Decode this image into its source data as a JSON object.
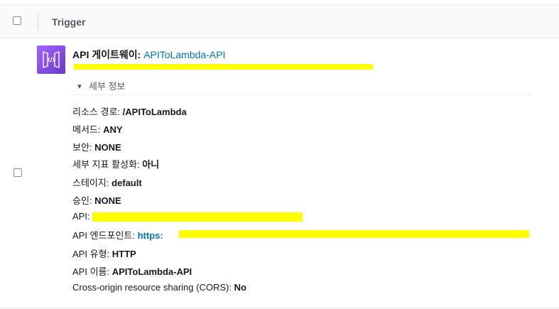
{
  "header": {
    "column_title": "Trigger"
  },
  "trigger": {
    "icon": "api-gateway-icon",
    "type_label": "API 게이트웨이:",
    "api_link": "APIToLambda-API",
    "details_toggle": "세부 정보",
    "details": [
      {
        "label": "리소스 경로:",
        "value": "/APIToLambda"
      },
      {
        "label": "메서드:",
        "value": "ANY"
      },
      {
        "label": "보안:",
        "value": "NONE"
      },
      {
        "label": "세부 지표 활성화:",
        "value": "아니"
      },
      {
        "label": "스테이지:",
        "value": "default"
      },
      {
        "label": "승인:",
        "value": "NONE"
      },
      {
        "label": "API:",
        "value": ""
      },
      {
        "label": "API 엔드포인트:",
        "value": "https:"
      },
      {
        "label": "API 유형:",
        "value": "HTTP"
      },
      {
        "label": "API 이름:",
        "value": "APIToLambda-API"
      },
      {
        "label": "Cross-origin resource sharing (CORS):",
        "value": "No"
      }
    ]
  },
  "colors": {
    "accent_link": "#0073bb",
    "icon_purple": "#8c4fff",
    "redaction": "#ffff00"
  }
}
